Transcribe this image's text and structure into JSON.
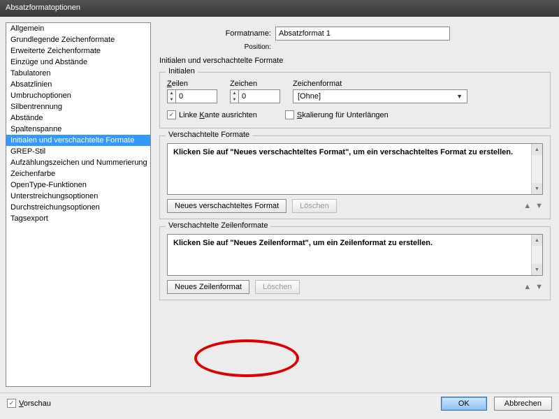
{
  "titlebar": "Absatzformatoptionen",
  "sidebar": {
    "items": [
      {
        "label": "Allgemein"
      },
      {
        "label": "Grundlegende Zeichenformate"
      },
      {
        "label": "Erweiterte Zeichenformate"
      },
      {
        "label": "Einzüge und Abstände"
      },
      {
        "label": "Tabulatoren"
      },
      {
        "label": "Absatzlinien"
      },
      {
        "label": "Umbruchoptionen"
      },
      {
        "label": "Silbentrennung"
      },
      {
        "label": "Abstände"
      },
      {
        "label": "Spaltenspanne"
      },
      {
        "label": "Initialen und verschachtelte Formate",
        "selected": true
      },
      {
        "label": "GREP-Stil"
      },
      {
        "label": "Aufzählungszeichen und Nummerierung"
      },
      {
        "label": "Zeichenfarbe"
      },
      {
        "label": "OpenType-Funktionen"
      },
      {
        "label": "Unterstreichungsoptionen"
      },
      {
        "label": "Durchstreichungsoptionen"
      },
      {
        "label": "Tagsexport"
      }
    ]
  },
  "header": {
    "formatname_label": "Formatname:",
    "formatname_value": "Absatzformat 1",
    "position_label": "Position:",
    "section_title": "Initialen und verschachtelte Formate"
  },
  "initials": {
    "legend": "Initialen",
    "lines_label": "Zeilen",
    "lines_value": "0",
    "chars_label": "Zeichen",
    "chars_value": "0",
    "charstyle_label": "Zeichenformat",
    "charstyle_value": "[Ohne]",
    "align_left_label": "Linke Kante ausrichten",
    "align_left_checked": true,
    "descenders_label": "Skalierung für Unterlängen",
    "descenders_checked": false
  },
  "nested": {
    "legend": "Verschachtelte Formate",
    "hint": "Klicken Sie auf \"Neues verschachteltes Format\", um ein verschachteltes Format zu erstellen.",
    "new_btn": "Neues verschachteltes Format",
    "delete_btn": "Löschen"
  },
  "nested_lines": {
    "legend": "Verschachtelte Zeilenformate",
    "hint": "Klicken Sie auf \"Neues Zeilenformat\", um ein Zeilenformat zu erstellen.",
    "new_btn": "Neues Zeilenformat",
    "delete_btn": "Löschen"
  },
  "footer": {
    "preview_label": "Vorschau",
    "ok": "OK",
    "cancel": "Abbrechen"
  }
}
